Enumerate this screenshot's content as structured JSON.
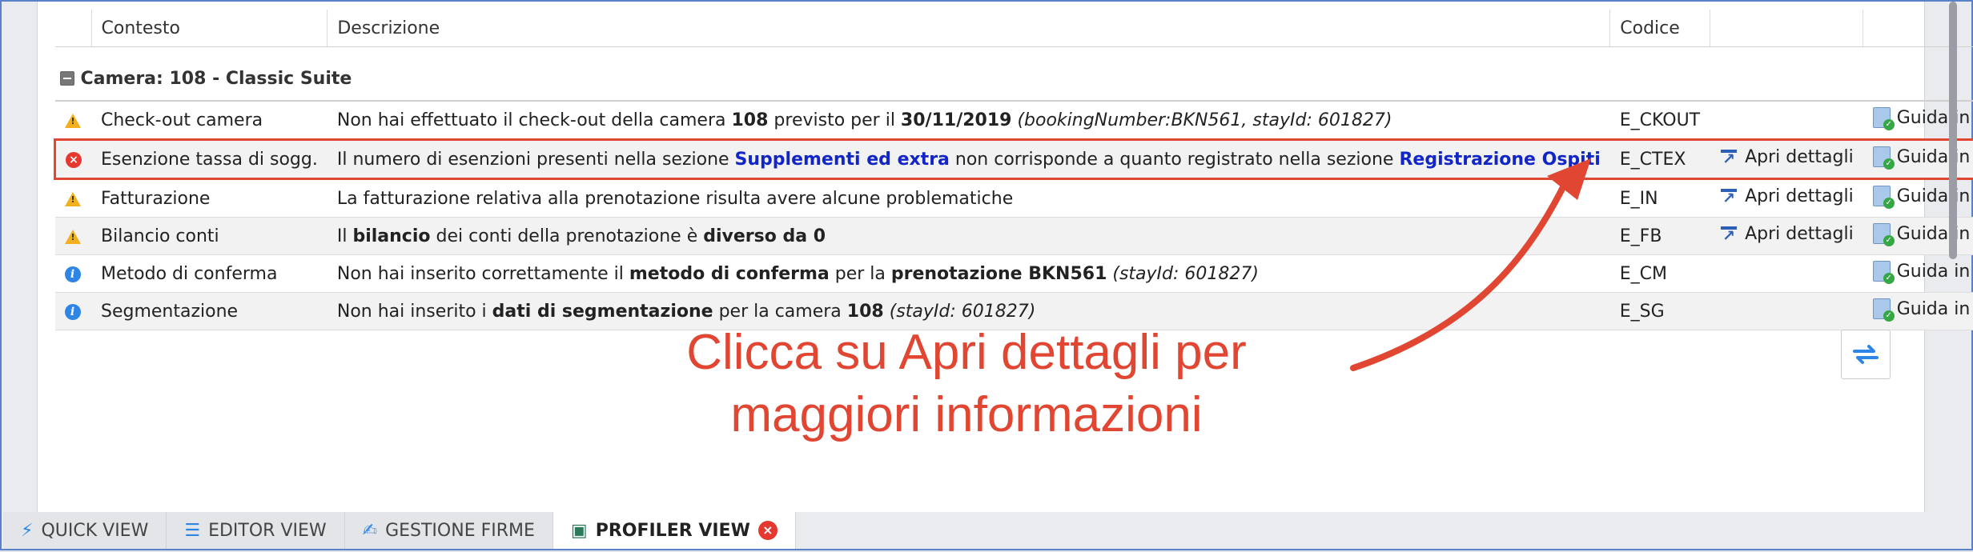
{
  "columns": {
    "context": "Contesto",
    "description": "Descrizione",
    "code": "Codice"
  },
  "group": {
    "label": "Camera: 108 - Classic Suite"
  },
  "rows": [
    {
      "level": "warning",
      "context": "Check-out camera",
      "desc": {
        "t1": "Non hai effettuato il check-out della camera ",
        "b1": "108",
        "t2": " previsto per il ",
        "b2": "30/11/2019",
        "i1": " (bookingNumber:BKN561, stayId: 601827)"
      },
      "code": "E_CKOUT",
      "details": "",
      "guide": "Guida in linea"
    },
    {
      "level": "error",
      "context": "Esenzione tassa di sogg.",
      "desc": {
        "t1": "Il numero di esenzioni presenti nella sezione ",
        "a1": "Supplementi ed extra",
        "t2": " non corrisponde a quanto registrato nella sezione ",
        "a2": "Registrazione Ospiti"
      },
      "code": "E_CTEX",
      "details": "Apri dettagli",
      "guide": "Guida in linea"
    },
    {
      "level": "warning",
      "context": "Fatturazione",
      "desc": {
        "t1": "La fatturazione relativa alla prenotazione risulta avere alcune problematiche"
      },
      "code": "E_IN",
      "details": "Apri dettagli",
      "guide": "Guida in linea"
    },
    {
      "level": "warning",
      "context": "Bilancio conti",
      "desc": {
        "t1": "Il ",
        "b1": "bilancio",
        "t2": " dei conti della prenotazione è ",
        "b2": "diverso da 0"
      },
      "code": "E_FB",
      "details": "Apri dettagli",
      "guide": "Guida in linea"
    },
    {
      "level": "info",
      "context": "Metodo di conferma",
      "desc": {
        "t1": "Non hai inserito correttamente il ",
        "b1": "metodo di conferma",
        "t2": " per la ",
        "b2": "prenotazione BKN561",
        "i1": " (stayId: 601827)"
      },
      "code": "E_CM",
      "details": "",
      "guide": "Guida in linea"
    },
    {
      "level": "info",
      "context": "Segmentazione",
      "desc": {
        "t1": "Non hai inserito i ",
        "b1": "dati di segmentazione",
        "t2": " per la camera ",
        "b2": "108",
        "i1": " (stayId: 601827)"
      },
      "code": "E_SG",
      "details": "",
      "guide": "Guida in linea"
    }
  ],
  "annotation": {
    "line1": "Clicca su Apri dettagli per",
    "line2": "maggiori informazioni"
  },
  "tabs": [
    {
      "label": "QUICK VIEW",
      "icon": "lightning-icon"
    },
    {
      "label": "EDITOR VIEW",
      "icon": "editor-icon"
    },
    {
      "label": "GESTIONE FIRME",
      "icon": "signature-icon"
    },
    {
      "label": "PROFILER VIEW",
      "icon": "monitor-icon",
      "active": true
    }
  ],
  "colors": {
    "accent": "#e04632",
    "link": "#1226c8",
    "frame": "#5a82c8"
  }
}
